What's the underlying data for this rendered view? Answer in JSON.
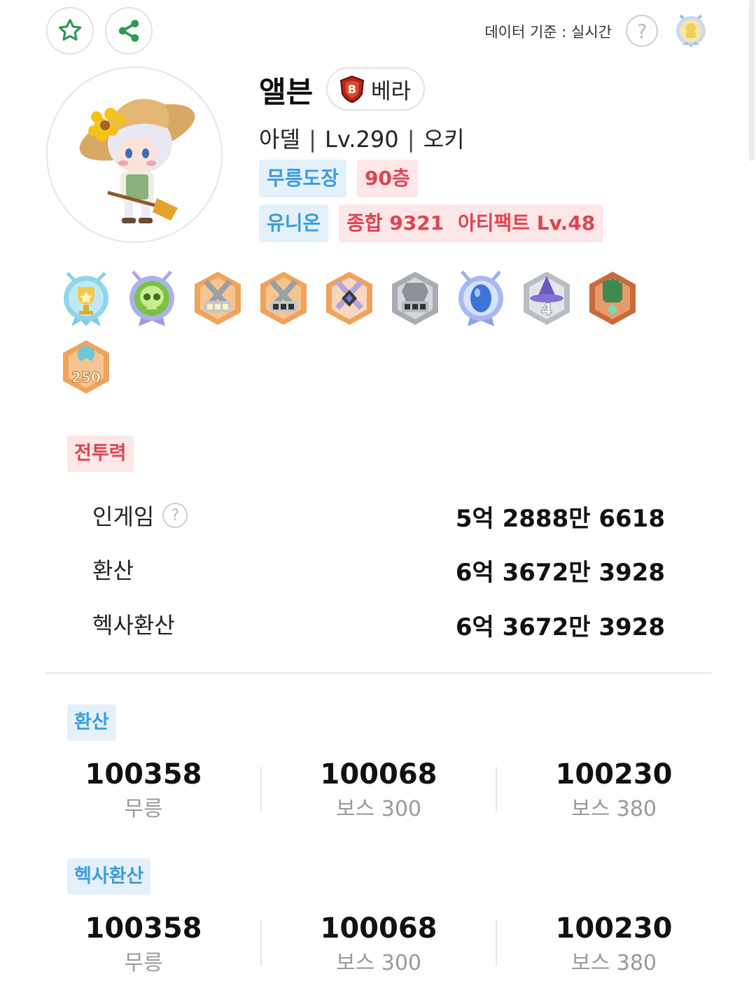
{
  "header": {
    "favorite_icon": "star-outline-icon",
    "share_icon": "share-icon",
    "data_basis": "데이터 기준 : 실시간",
    "help_symbol": "?",
    "accent_green": "#2e9a55"
  },
  "profile": {
    "name": "앨븐",
    "world": "베라",
    "job": "아델",
    "level": "Lv.290",
    "guild": "오키",
    "separator": "|",
    "tags_row1": [
      {
        "label": "무릉도장",
        "style": "blue"
      },
      {
        "label": "90층",
        "style": "red"
      }
    ],
    "tags_row2": [
      {
        "label": "유니온",
        "style": "blue"
      },
      {
        "label": "종합 9321",
        "style": "red"
      },
      {
        "label": "아티팩트 Lv.48",
        "style": "red"
      }
    ]
  },
  "achievements": [
    "trophy-badge-icon",
    "skull-badge-icon",
    "crossed-swords-badge-icon-1",
    "crossed-swords-badge-icon-2",
    "crossed-swords-gem-badge-icon",
    "armor-badge-icon",
    "blue-egg-badge-icon",
    "witch-hat-4-badge-icon",
    "green-glove-badge-icon",
    "level-250-badge-icon"
  ],
  "badge_level_text": "250",
  "witch_badge_number": "4",
  "combat_power": {
    "label": "전투력",
    "rows": [
      {
        "label": "인게임",
        "value": "5억 2888만 6618",
        "help": "?"
      },
      {
        "label": "환산",
        "value": "6억 3672만 3928"
      },
      {
        "label": "헥사환산",
        "value": "6억 3672만 3928"
      }
    ]
  },
  "converted": {
    "label": "환산",
    "stats": [
      {
        "value": "100358",
        "caption": "무릉"
      },
      {
        "value": "100068",
        "caption": "보스 300"
      },
      {
        "value": "100230",
        "caption": "보스 380"
      }
    ]
  },
  "hexa_converted": {
    "label": "헥사환산",
    "stats": [
      {
        "value": "100358",
        "caption": "무릉"
      },
      {
        "value": "100068",
        "caption": "보스 300"
      },
      {
        "value": "100230",
        "caption": "보스 380"
      }
    ]
  },
  "colors": {
    "tag_blue_bg": "#e4f1fb",
    "tag_blue_text": "#3d9ddc",
    "tag_red_bg": "#fde7e8",
    "tag_red_text": "#e0444f"
  }
}
